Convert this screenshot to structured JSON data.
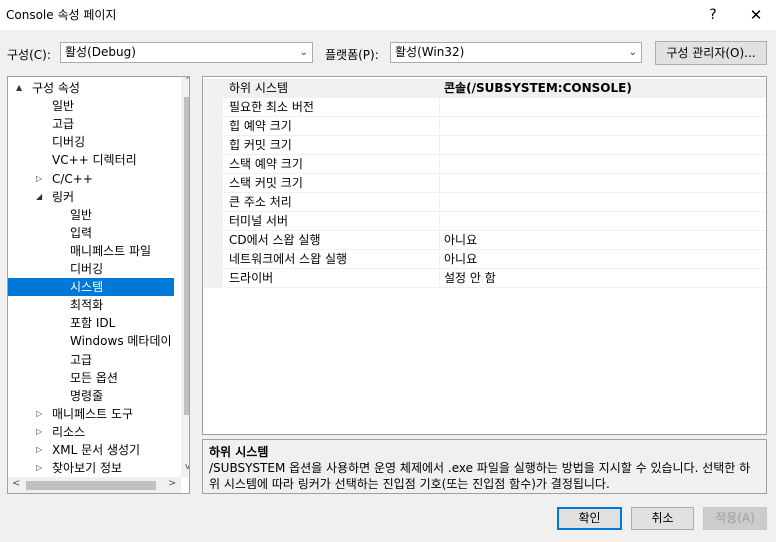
{
  "window": {
    "title": "Console 속성 페이지",
    "help": "?",
    "close": "✕"
  },
  "toolbar": {
    "config_label": "구성(C):",
    "config_value": "활성(Debug)",
    "platform_label": "플랫폼(P):",
    "platform_value": "활성(Win32)",
    "config_manager": "구성 관리자(O)..."
  },
  "tree": {
    "items": [
      {
        "label": "구성 속성",
        "expander": "▲"
      },
      {
        "label": "일반"
      },
      {
        "label": "고급"
      },
      {
        "label": "디버깅"
      },
      {
        "label": "VC++ 디렉터리"
      },
      {
        "label": "C/C++",
        "expander": "▷"
      },
      {
        "label": "링커",
        "expander": "◢"
      },
      {
        "label": "일반"
      },
      {
        "label": "입력"
      },
      {
        "label": "매니페스트 파일"
      },
      {
        "label": "디버깅"
      },
      {
        "label": "시스템",
        "selected": true
      },
      {
        "label": "최적화"
      },
      {
        "label": "포함 IDL"
      },
      {
        "label": "Windows 메타데이"
      },
      {
        "label": "고급"
      },
      {
        "label": "모든 옵션"
      },
      {
        "label": "명령줄"
      },
      {
        "label": "매니페스트 도구",
        "expander": "▷"
      },
      {
        "label": "리소스",
        "expander": "▷"
      },
      {
        "label": "XML 문서 생성기",
        "expander": "▷"
      },
      {
        "label": "찾아보기 정보",
        "expander": "▷"
      }
    ],
    "scroll_left": "<",
    "scroll_right": ">",
    "scroll_up": "^",
    "scroll_down": "v"
  },
  "properties": [
    {
      "name": "하위 시스템",
      "value": "콘솔(/SUBSYSTEM:CONSOLE)",
      "bold": true,
      "selected": true
    },
    {
      "name": "필요한 최소 버전",
      "value": ""
    },
    {
      "name": "힙 예약 크기",
      "value": ""
    },
    {
      "name": "힙 커밋 크기",
      "value": ""
    },
    {
      "name": "스택 예약 크기",
      "value": ""
    },
    {
      "name": "스택 커밋 크기",
      "value": ""
    },
    {
      "name": "큰 주소 처리",
      "value": ""
    },
    {
      "name": "터미널 서버",
      "value": ""
    },
    {
      "name": "CD에서 스왑 실행",
      "value": "아니요"
    },
    {
      "name": "네트워크에서 스왑 실행",
      "value": "아니요"
    },
    {
      "name": "드라이버",
      "value": "설정 안 함"
    }
  ],
  "description": {
    "title": "하위 시스템",
    "text": "/SUBSYSTEM 옵션을 사용하면 운영 체제에서 .exe 파일을 실행하는 방법을 지시할 수 있습니다. 선택한 하위 시스템에 따라 링커가 선택하는 진입점 기호(또는 진입점 함수)가 결정됩니다."
  },
  "buttons": {
    "ok": "확인",
    "cancel": "취소",
    "apply": "적용(A)"
  },
  "colors": {
    "selection": "#0078d7",
    "dialog_bg": "#f0f0f0"
  }
}
